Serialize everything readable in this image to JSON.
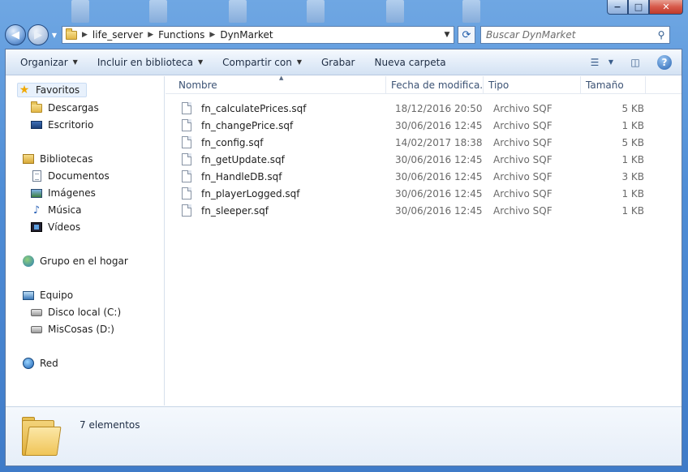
{
  "window": {
    "minimize_glyph": "−",
    "maximize_glyph": "□",
    "close_glyph": "✕"
  },
  "nav": {
    "back_glyph": "◀",
    "forward_glyph": "▶",
    "breadcrumb": [
      "life_server",
      "Functions",
      "DynMarket"
    ],
    "search_placeholder": "Buscar DynMarket"
  },
  "toolbar": {
    "organize": "Organizar",
    "include_library": "Incluir en biblioteca",
    "share": "Compartir con",
    "burn": "Grabar",
    "new_folder": "Nueva carpeta"
  },
  "sidebar": {
    "favorites": "Favoritos",
    "downloads": "Descargas",
    "desktop": "Escritorio",
    "libraries": "Bibliotecas",
    "documents": "Documentos",
    "images": "Imágenes",
    "music": "Música",
    "videos": "Vídeos",
    "homegroup": "Grupo en el hogar",
    "computer": "Equipo",
    "disk_c": "Disco local (C:)",
    "disk_d": "MisCosas (D:)",
    "network": "Red"
  },
  "columns": {
    "name": "Nombre",
    "date": "Fecha de modifica...",
    "type": "Tipo",
    "size": "Tamaño"
  },
  "files": [
    {
      "name": "fn_calculatePrices.sqf",
      "date": "18/12/2016 20:50",
      "type": "Archivo SQF",
      "size": "5 KB"
    },
    {
      "name": "fn_changePrice.sqf",
      "date": "30/06/2016 12:45",
      "type": "Archivo SQF",
      "size": "1 KB"
    },
    {
      "name": "fn_config.sqf",
      "date": "14/02/2017 18:38",
      "type": "Archivo SQF",
      "size": "5 KB"
    },
    {
      "name": "fn_getUpdate.sqf",
      "date": "30/06/2016 12:45",
      "type": "Archivo SQF",
      "size": "1 KB"
    },
    {
      "name": "fn_HandleDB.sqf",
      "date": "30/06/2016 12:45",
      "type": "Archivo SQF",
      "size": "3 KB"
    },
    {
      "name": "fn_playerLogged.sqf",
      "date": "30/06/2016 12:45",
      "type": "Archivo SQF",
      "size": "1 KB"
    },
    {
      "name": "fn_sleeper.sqf",
      "date": "30/06/2016 12:45",
      "type": "Archivo SQF",
      "size": "1 KB"
    }
  ],
  "status": {
    "item_count": "7 elementos"
  }
}
